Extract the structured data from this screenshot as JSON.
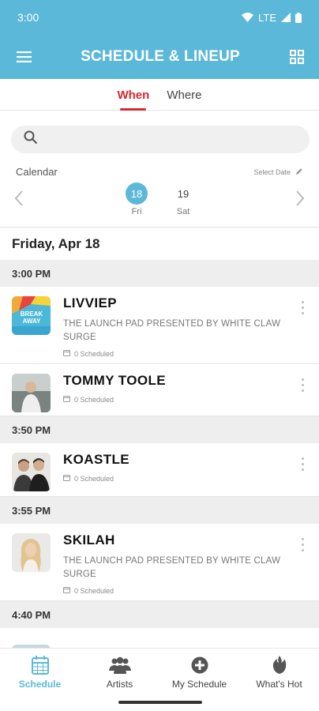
{
  "status_bar": {
    "time": "3:00",
    "network": "LTE"
  },
  "app_bar": {
    "title": "SCHEDULE & LINEUP",
    "menu_icon": "menu-icon",
    "grid_icon": "grid-icon"
  },
  "tabs": [
    {
      "label": "When",
      "active": true
    },
    {
      "label": "Where",
      "active": false
    }
  ],
  "search": {
    "placeholder": "",
    "icon": "search-icon"
  },
  "calendar": {
    "label": "Calendar",
    "select_date_label": "Select Date",
    "days": [
      {
        "num": "18",
        "name": "Fri",
        "selected": true
      },
      {
        "num": "19",
        "name": "Sat",
        "selected": false
      }
    ]
  },
  "date_heading": "Friday, Apr 18",
  "sections": [
    {
      "time": "3:00 PM",
      "acts": [
        {
          "name": "LIVVIEP",
          "stage": "THE LAUNCH PAD PRESENTED BY WHITE CLAW SURGE",
          "scheduled": "0 Scheduled",
          "thumb_text": "BREAK AWAY"
        },
        {
          "name": "TOMMY TOOLE",
          "stage": "",
          "scheduled": "0 Scheduled"
        }
      ]
    },
    {
      "time": "3:50 PM",
      "acts": [
        {
          "name": "KOASTLE",
          "stage": "",
          "scheduled": "0 Scheduled"
        }
      ]
    },
    {
      "time": "3:55 PM",
      "acts": [
        {
          "name": "SKILAH",
          "stage": "THE LAUNCH PAD PRESENTED BY WHITE CLAW SURGE",
          "scheduled": "0 Scheduled"
        }
      ]
    },
    {
      "time": "4:40 PM",
      "acts": []
    }
  ],
  "bottom_nav": [
    {
      "label": "Schedule",
      "icon": "calendar-icon",
      "active": true
    },
    {
      "label": "Artists",
      "icon": "people-icon",
      "active": false
    },
    {
      "label": "My Schedule",
      "icon": "plus-circle-icon",
      "active": false
    },
    {
      "label": "What's Hot",
      "icon": "flame-icon",
      "active": false
    }
  ],
  "colors": {
    "brand": "#5cb8d8",
    "accent": "#d9282f"
  }
}
